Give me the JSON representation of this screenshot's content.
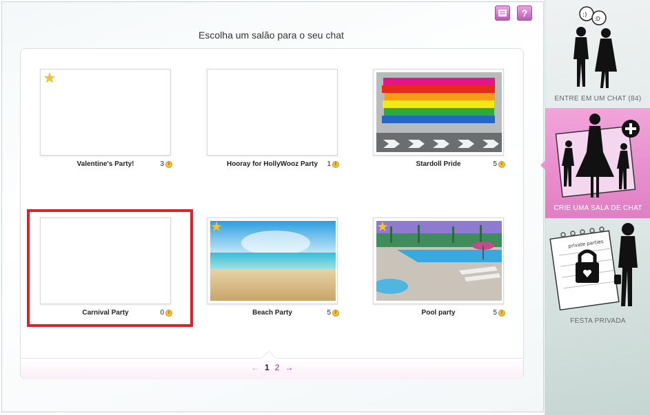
{
  "header": {
    "title": "Escolha um salão para o seu chat",
    "icons": [
      "messages-icon",
      "help-icon"
    ],
    "help_label": "?"
  },
  "rooms": [
    {
      "name": "Valentine's Party!",
      "count": "3",
      "starred": true,
      "image": "blank"
    },
    {
      "name": "Hooray for HollyWooz Party",
      "count": "1",
      "starred": false,
      "image": "blank"
    },
    {
      "name": "Stardoll Pride",
      "count": "5",
      "starred": false,
      "image": "rainbow-wall"
    },
    {
      "name": "Carnival Party",
      "count": "0",
      "starred": false,
      "image": "blank",
      "highlighted": true
    },
    {
      "name": "Beach Party",
      "count": "5",
      "starred": true,
      "image": "beach"
    },
    {
      "name": "Pool party",
      "count": "5",
      "starred": true,
      "image": "pool"
    }
  ],
  "coin_symbol": "i",
  "pagination": {
    "prev": "←",
    "current": "1",
    "pages": [
      "1",
      "2"
    ],
    "other_page": "2",
    "next": "→"
  },
  "sidebar": {
    "items": [
      {
        "label": "ENTRE EM UM CHAT (84)",
        "active": false,
        "icon": "chat-silhouettes-icon"
      },
      {
        "label": "CRIE UMA SALA DE CHAT",
        "active": true,
        "icon": "create-chat-icon"
      },
      {
        "label": "FESTA PRIVADA",
        "active": false,
        "icon": "private-party-calendar-icon"
      }
    ]
  },
  "colors": {
    "accent": "#8a2f8a",
    "active_tab": "#e07fc4",
    "highlight": "#e0202b",
    "star": "#f2c230"
  }
}
